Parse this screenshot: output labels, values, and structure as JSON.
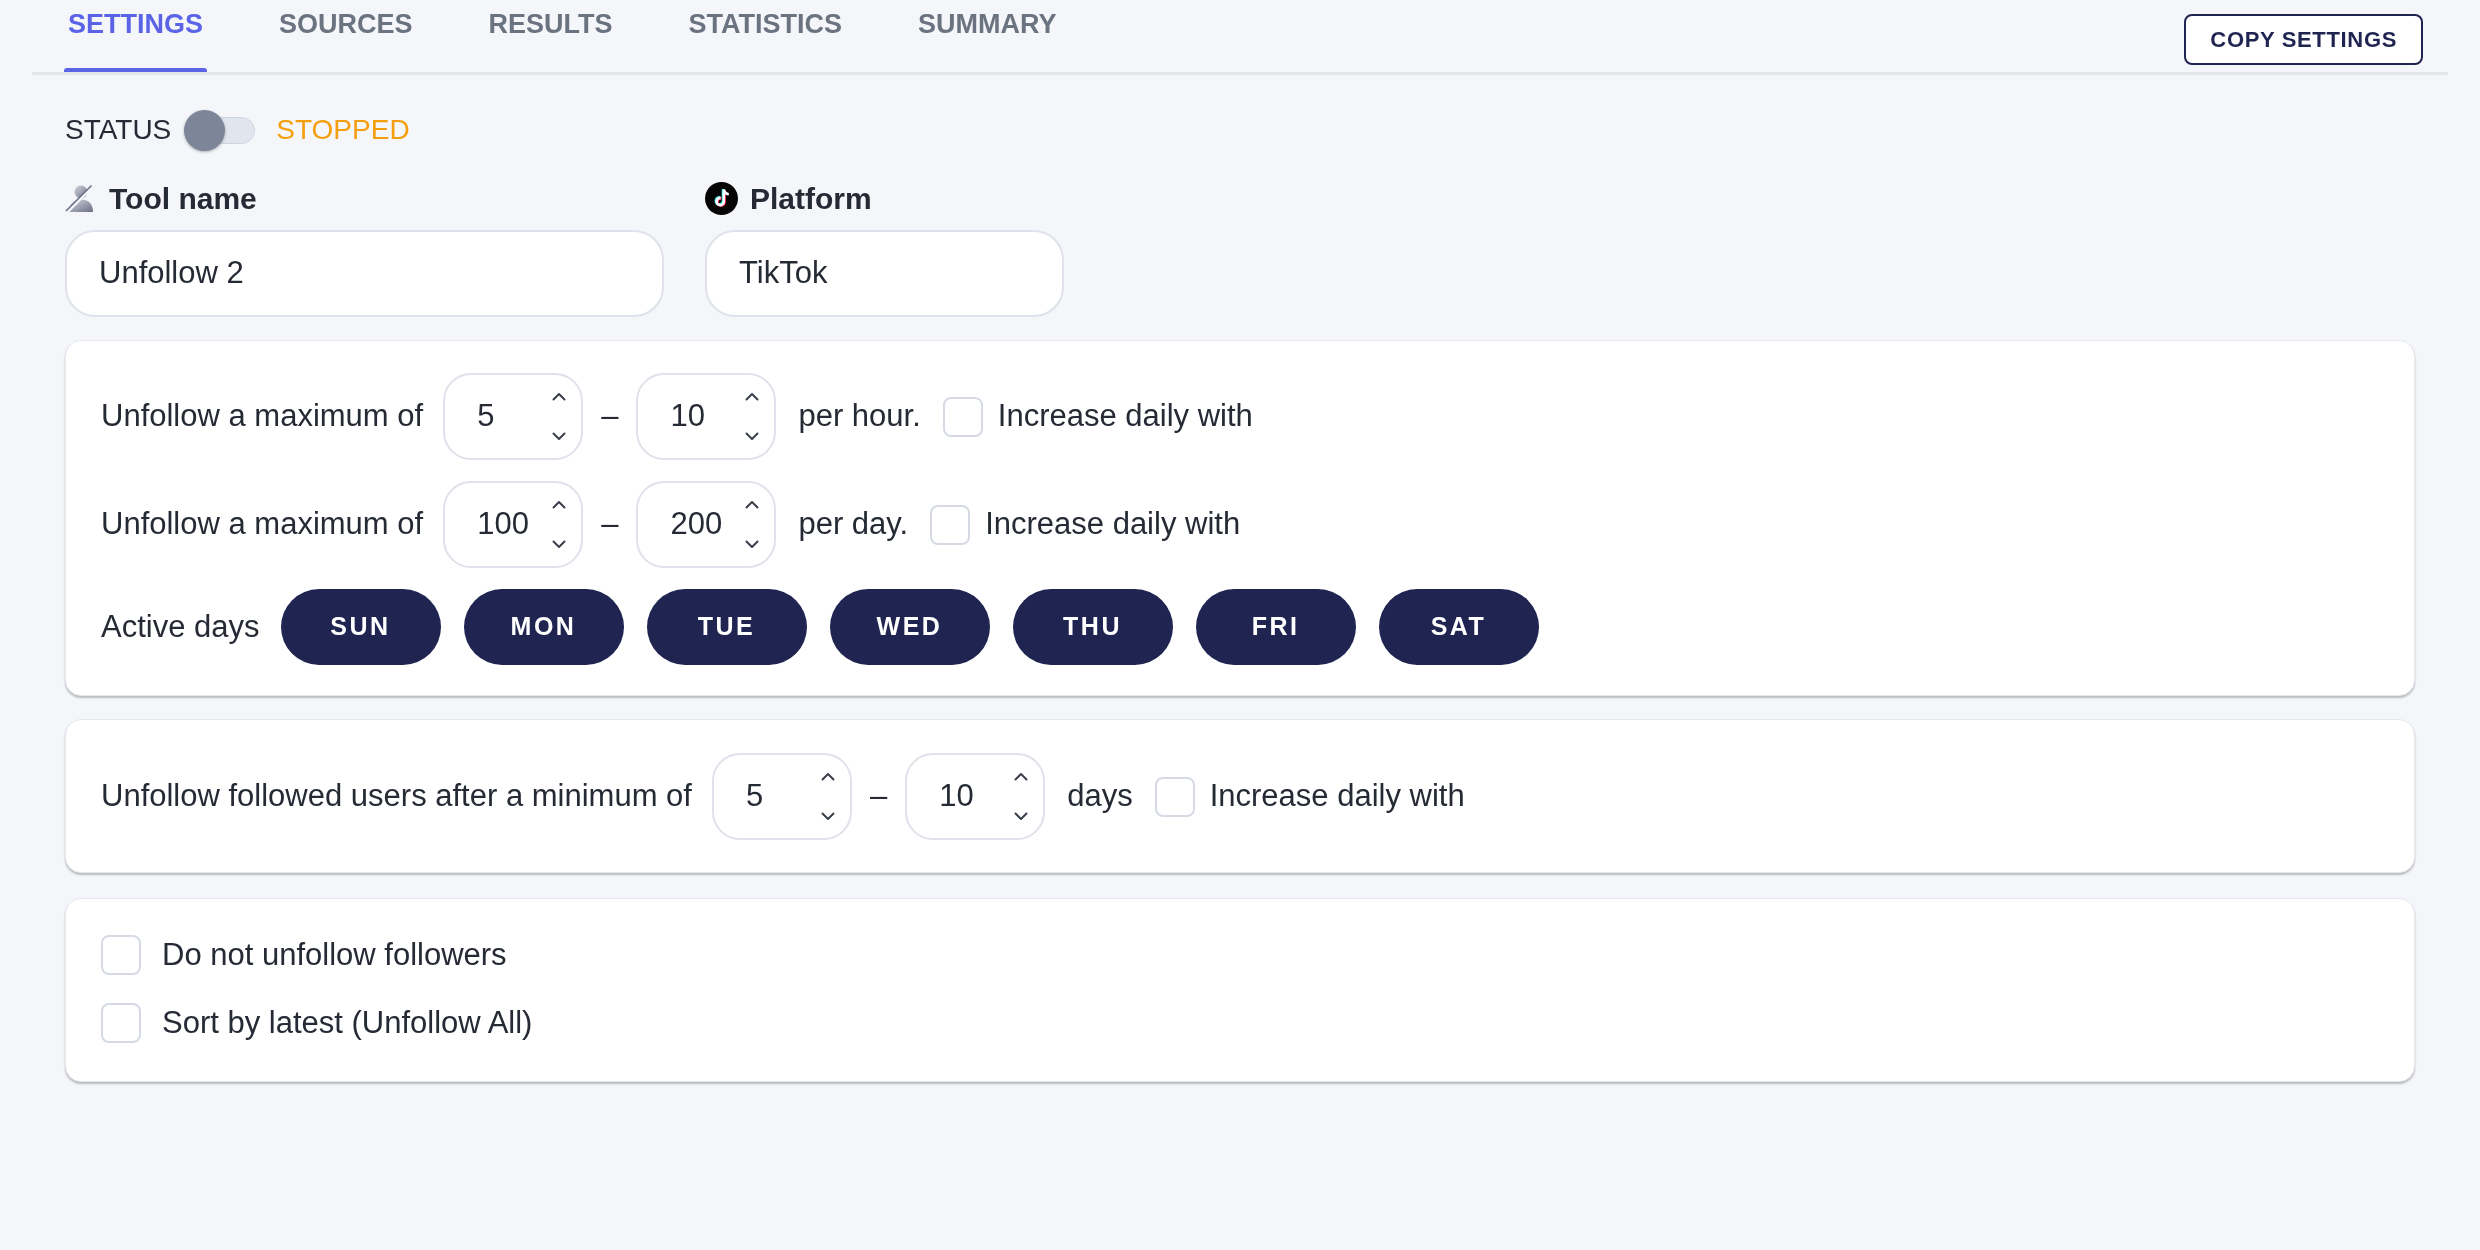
{
  "tabs": [
    {
      "label": "SETTINGS",
      "selected": true
    },
    {
      "label": "SOURCES",
      "selected": false
    },
    {
      "label": "RESULTS",
      "selected": false
    },
    {
      "label": "STATISTICS",
      "selected": false
    },
    {
      "label": "SUMMARY",
      "selected": false
    }
  ],
  "copy_button": "COPY SETTINGS",
  "status": {
    "label": "STATUS",
    "on": false,
    "state_text": "STOPPED"
  },
  "fields": [
    {
      "kind": "tool",
      "label": "Tool name",
      "value": "Unfollow 2"
    },
    {
      "kind": "platform",
      "label": "Platform",
      "value": "TikTok"
    }
  ],
  "limits": {
    "rows": [
      {
        "label": "Unfollow a maximum of",
        "min": "5",
        "separator": "–",
        "max": "10",
        "unit": "per hour.",
        "increase": {
          "label": "Increase daily with",
          "checked": false
        }
      },
      {
        "label": "Unfollow a maximum of",
        "min": "100",
        "separator": "–",
        "max": "200",
        "unit": "per day.",
        "increase": {
          "label": "Increase daily with",
          "checked": false
        }
      }
    ],
    "active_days": {
      "label": "Active days",
      "days": [
        {
          "label": "SUN",
          "selected": true
        },
        {
          "label": "MON",
          "selected": true
        },
        {
          "label": "TUE",
          "selected": true
        },
        {
          "label": "WED",
          "selected": true
        },
        {
          "label": "THU",
          "selected": true
        },
        {
          "label": "FRI",
          "selected": true
        },
        {
          "label": "SAT",
          "selected": true
        }
      ]
    }
  },
  "delay": {
    "rows": [
      {
        "label": "Unfollow followed users after a minimum of",
        "min": "5",
        "separator": "–",
        "max": "10",
        "unit": "days",
        "increase": {
          "label": "Increase daily with",
          "checked": false
        }
      }
    ]
  },
  "options": [
    {
      "label": "Do not unfollow followers",
      "checked": false
    },
    {
      "label": "Sort by latest (Unfollow All)",
      "checked": false
    }
  ]
}
